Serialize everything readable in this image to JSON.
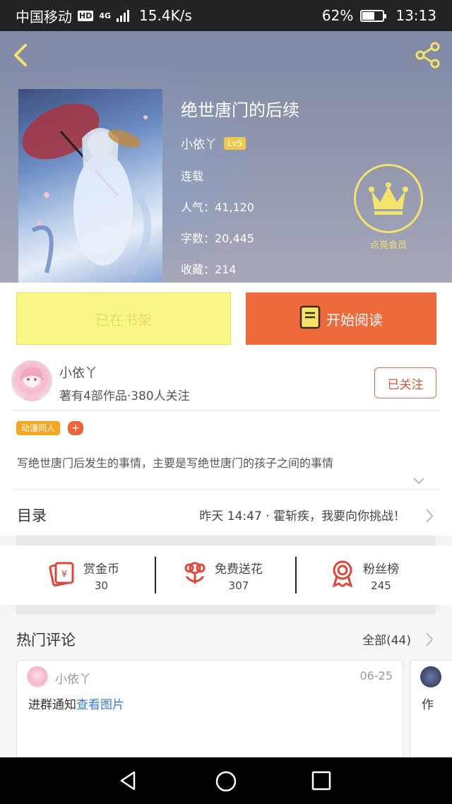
{
  "status_bar": {
    "carrier": "中国移动",
    "hd": "HD",
    "network": "4G",
    "speed": "15.4K/s",
    "battery_pct": "62%",
    "battery_level": 0.62,
    "time": "13:13"
  },
  "book": {
    "title": "绝世唐门的后续",
    "author": "小依丫",
    "level": "Lv5",
    "status": "连载",
    "popularity": "人气：41,120",
    "word_count": "字数：20,445",
    "favorites": "收藏：214",
    "vip_label": "点亮会员"
  },
  "actions": {
    "shelf_label": "已在书架",
    "read_label": "开始阅读"
  },
  "author_info": {
    "name": "小依丫",
    "summary": "著有4部作品·380人关注",
    "follow_label": "已关注",
    "tag": "动漫同人",
    "tag_add": "+",
    "description": "写绝世唐门后发生的事情，主要是写绝世唐门的孩子之间的事情"
  },
  "toc": {
    "label": "目录",
    "latest": "昨天 14:47 · 霍斩疾，我要向你挑战！"
  },
  "stats": [
    {
      "label": "赏金币",
      "value": "30"
    },
    {
      "label": "免费送花",
      "value": "307"
    },
    {
      "label": "粉丝榜",
      "value": "245"
    }
  ],
  "comments": {
    "title": "热门评论",
    "all_label": "全部(44)",
    "items": [
      {
        "user": "小依丫",
        "date": "06-25",
        "text": "进群通知",
        "link": "查看图片"
      },
      {
        "text": "作"
      }
    ]
  },
  "colors": {
    "accent_orange": "#ee6a3b",
    "shelf_yellow": "#fcf686",
    "vip_yellow": "#f4e36c",
    "icon_red": "#e0473a",
    "link_blue": "#3b7bd1"
  },
  "icons": [
    "back-icon",
    "share-icon",
    "crown-icon",
    "book-icon",
    "coin-icon",
    "flower-icon",
    "medal-icon",
    "chevron-right-icon",
    "chevron-down-icon",
    "nav-back-icon",
    "nav-home-icon",
    "nav-recent-icon"
  ]
}
